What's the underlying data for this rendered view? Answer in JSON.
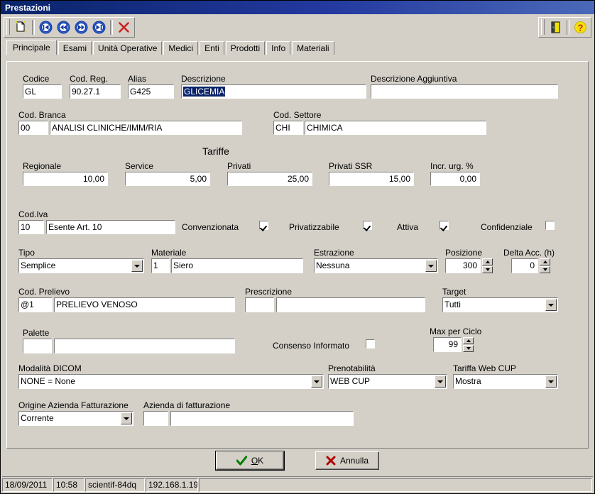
{
  "window": {
    "title": "Prestazioni"
  },
  "toolbar": {
    "buttons": [
      {
        "name": "new-document-icon",
        "glyph": "🗋"
      },
      {
        "name": "first-record-icon",
        "glyph": "⏮"
      },
      {
        "name": "previous-record-icon",
        "glyph": "⏪"
      },
      {
        "name": "next-record-icon",
        "glyph": "⏩"
      },
      {
        "name": "last-record-icon",
        "glyph": "⏭"
      },
      {
        "name": "delete-icon",
        "glyph": "✕"
      }
    ],
    "right_buttons": [
      {
        "name": "exit-door-icon",
        "glyph": "⬛"
      },
      {
        "name": "help-icon",
        "glyph": "?"
      }
    ]
  },
  "tabs": [
    {
      "label": "Principale",
      "active": true
    },
    {
      "label": "Esami",
      "active": false
    },
    {
      "label": "Unità Operative",
      "active": false
    },
    {
      "label": "Medici",
      "active": false
    },
    {
      "label": "Enti",
      "active": false
    },
    {
      "label": "Prodotti",
      "active": false
    },
    {
      "label": "Info",
      "active": false
    },
    {
      "label": "Materiali",
      "active": false
    }
  ],
  "form": {
    "codice": {
      "label": "Codice",
      "value": "GL"
    },
    "cod_reg": {
      "label": "Cod. Reg.",
      "value": "90.27.1"
    },
    "alias": {
      "label": "Alias",
      "value": "G425"
    },
    "descrizione": {
      "label": "Descrizione",
      "value": "GLICEMIA",
      "selected": true
    },
    "descrizione_aggiuntiva": {
      "label": "Descrizione Aggiuntiva",
      "value": ""
    },
    "cod_branca": {
      "label": "Cod. Branca",
      "code": "00",
      "value": "ANALISI CLINICHE/IMM/RIA"
    },
    "cod_settore": {
      "label": "Cod. Settore",
      "code": "CHI",
      "value": "CHIMICA"
    },
    "tariffe": {
      "title": "Tariffe",
      "regionale": {
        "label": "Regionale",
        "value": "10,00"
      },
      "service": {
        "label": "Service",
        "value": "5,00"
      },
      "privati": {
        "label": "Privati",
        "value": "25,00"
      },
      "privati_ssr": {
        "label": "Privati SSR",
        "value": "15,00"
      },
      "incr_urg": {
        "label": "Incr. urg. %",
        "value": "0,00"
      }
    },
    "cod_iva": {
      "label": "Cod.Iva",
      "code": "10",
      "value": "Esente Art. 10"
    },
    "checkboxes": [
      {
        "label": "Convenzionata",
        "checked": true
      },
      {
        "label": "Privatizzabile",
        "checked": true
      },
      {
        "label": "Attiva",
        "checked": true
      },
      {
        "label": "Confidenziale",
        "checked": false
      }
    ],
    "tipo": {
      "label": "Tipo",
      "value": "Semplice"
    },
    "materiale": {
      "label": "Materiale",
      "code": "1",
      "value": "Siero"
    },
    "estrazione": {
      "label": "Estrazione",
      "value": "Nessuna"
    },
    "posizione": {
      "label": "Posizione",
      "value": "300"
    },
    "delta_acc": {
      "label": "Delta Acc. (h)",
      "value": "0"
    },
    "cod_prelievo": {
      "label": "Cod. Prelievo",
      "code": "@1",
      "value": "PRELIEVO VENOSO"
    },
    "prescrizione": {
      "label": "Prescrizione",
      "code": "",
      "value": ""
    },
    "target": {
      "label": "Target",
      "value": "Tutti"
    },
    "palette": {
      "label": "Palette",
      "code": "",
      "value": ""
    },
    "consenso_informato": {
      "label": "Consenso Informato",
      "checked": false
    },
    "max_per_ciclo": {
      "label": "Max per Ciclo",
      "value": "99"
    },
    "modalita_dicom": {
      "label": "Modalità DICOM",
      "value": "NONE = None"
    },
    "prenotabilita": {
      "label": "Prenotabilità",
      "value": "WEB CUP"
    },
    "tariffa_web_cup": {
      "label": "Tariffa Web CUP",
      "value": "Mostra"
    },
    "origine_azienda": {
      "label": "Origine Azienda Fatturazione",
      "value": "Corrente"
    },
    "azienda_fatturazione": {
      "label": "Azienda di fatturazione",
      "code": "",
      "value": ""
    }
  },
  "buttons": {
    "ok": "OK",
    "ok_accel": "O",
    "ok_rest": "K",
    "cancel": "Annulla"
  },
  "statusbar": {
    "date": "18/09/2011",
    "time": "10:58",
    "host": "scientif-84dq",
    "ip": "192.168.1.19"
  },
  "colors": {
    "titlebar_start": "#0a246a",
    "titlebar_end": "#4b69b8",
    "face": "#d4d0c8",
    "selection": "#0a246a",
    "field_bg": "#ffffff",
    "nav_icon": "#1648c8",
    "delete_icon": "#cc2222",
    "help_icon": "#cc2222"
  }
}
